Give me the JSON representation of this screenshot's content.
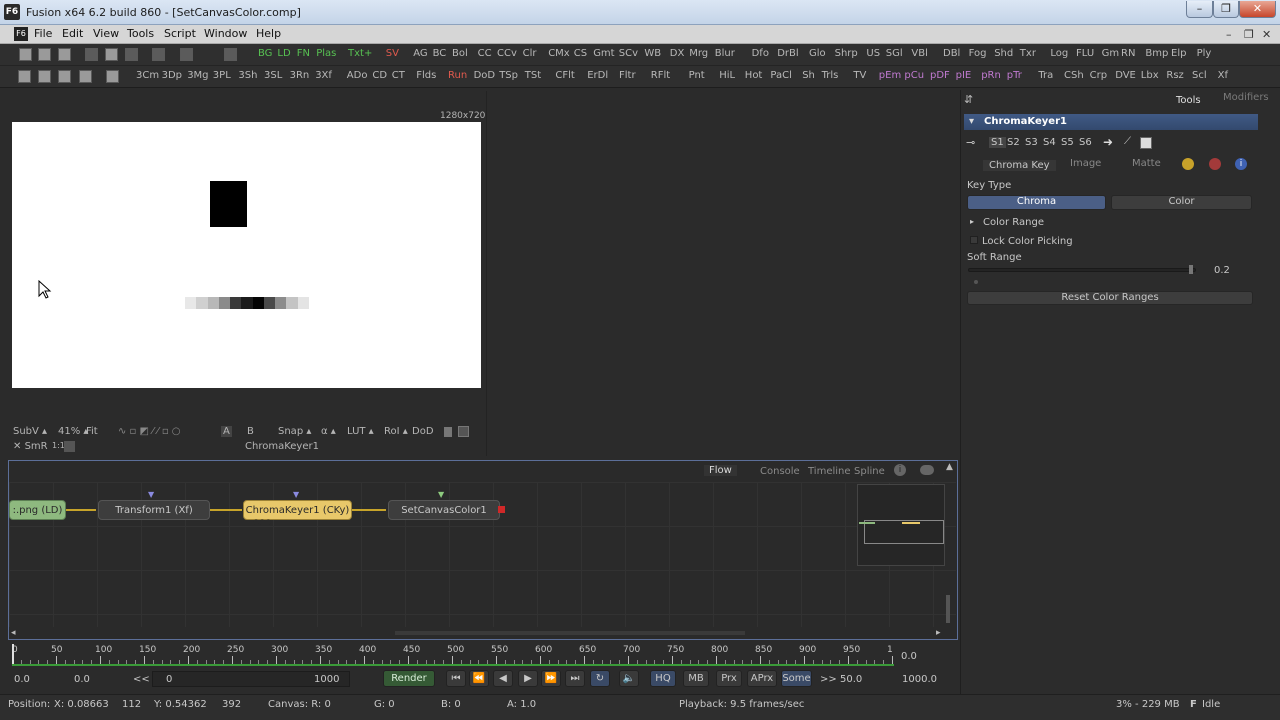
{
  "window": {
    "title": "Fusion x64 6.2 build 860 - [SetCanvasColor.comp]",
    "app_icon": "F6",
    "minimize": "–",
    "restore": "❐",
    "close": "✕"
  },
  "menu": [
    "File",
    "Edit",
    "View",
    "Tools",
    "Script",
    "Window",
    "Help"
  ],
  "toolbar1": {
    "tools": [
      "BG",
      "LD",
      "FN",
      "Plas",
      "Txt+",
      "SV",
      "AG",
      "BC",
      "Bol",
      "CC",
      "CCv",
      "Clr",
      "CMx",
      "CS",
      "Gmt",
      "SCv",
      "WB",
      "DX",
      "Mrg",
      "Blur",
      "Dfo",
      "DrBl",
      "Glo",
      "Shrp",
      "US",
      "SGl",
      "VBl",
      "DBl",
      "Fog",
      "Shd",
      "Txr",
      "Log",
      "FLU",
      "Gm",
      "RN",
      "Bmp",
      "Elp",
      "Ply"
    ]
  },
  "toolbar2": {
    "tools": [
      "3Cm",
      "3Dp",
      "3Mg",
      "3PL",
      "3Sh",
      "3SL",
      "3Rn",
      "3Xf",
      "ADo",
      "CD",
      "CT",
      "Flds",
      "Run",
      "DoD",
      "TSp",
      "TSt",
      "CFlt",
      "ErDl",
      "Fltr",
      "RFlt",
      "Pnt",
      "HiL",
      "Hot",
      "PaCl",
      "Sh",
      "Trls",
      "TV",
      "pEm",
      "pCu",
      "pDF",
      "pIE",
      "pRn",
      "pTr",
      "Tra",
      "CSh",
      "Crp",
      "DVE",
      "Lbx",
      "Rsz",
      "Scl",
      "Xf"
    ]
  },
  "colors": {
    "generator_tool": "#57c152",
    "saver_tool": "#e05a4e",
    "particle_tool": "#c07ad0",
    "run_tool": "#e05a4e",
    "node_selected": "#e8c86a",
    "node_loader": "#8eb97f",
    "accent_blue": "#4b5f86"
  },
  "viewer": {
    "resolution": "1280x720",
    "subv": "SubV ▴",
    "zoom": "41% ▴",
    "fit": "Fit",
    "ab_a": "A",
    "ab_b": "B",
    "snap": "Snap ▴",
    "alpha": "α ▴",
    "lut": "LUT ▴",
    "roi": "RoI ▴",
    "dod": "DoD",
    "smr": "SmR",
    "ratio": "1:1",
    "node_name": "ChromaKeyer1",
    "bar_shades": [
      "#e8e8e8",
      "#d0d0d0",
      "#b8b8b8",
      "#8a8a8a",
      "#3a3a3a",
      "#1c1c1c",
      "#050505",
      "#4a4a4a",
      "#8c8c8c",
      "#c4c4c4",
      "#e4e4e4"
    ]
  },
  "inspector": {
    "tabs": [
      "Tools",
      "Modifiers"
    ],
    "tool_name": "ChromaKeyer1",
    "slots": [
      "S1",
      "S2",
      "S3",
      "S4",
      "S5",
      "S6"
    ],
    "subtabs": [
      "Chroma Key",
      "Image",
      "Matte"
    ],
    "key_type_label": "Key Type",
    "key_type_options": [
      "Chroma",
      "Color"
    ],
    "color_range_label": "Color Range",
    "lock_color_picking_label": "Lock Color Picking",
    "soft_range_label": "Soft Range",
    "soft_range_value": "0.2",
    "soft_range_fraction": 0.98,
    "reset_button": "Reset Color Ranges"
  },
  "flow": {
    "tabs": [
      "Flow",
      "Console",
      "Timeline",
      "Spline"
    ],
    "nodes": [
      {
        "label": ":.png  (LD)",
        "type": "loader"
      },
      {
        "label": "Transform1  (Xf)",
        "type": "normal"
      },
      {
        "label": "ChromaKeyer1  (CKy)",
        "type": "selected"
      },
      {
        "label": "SetCanvasColor1",
        "type": "normal"
      }
    ]
  },
  "timeline": {
    "ticks": [
      "0",
      "50",
      "100",
      "150",
      "200",
      "250",
      "300",
      "350",
      "400",
      "450",
      "500",
      "550",
      "600",
      "650",
      "700",
      "750",
      "800",
      "850",
      "900",
      "950",
      "1"
    ],
    "current_value": "0.0"
  },
  "transport": {
    "global_start": "0.0",
    "render_start": "0.0",
    "rewind_label": "<<",
    "current_frame": "0",
    "render_end": "1000",
    "render_button": "Render",
    "hq": "HQ",
    "mb": "MB",
    "prx": "Prx",
    "aprx": "APrx",
    "some": "Some",
    "ff_label": ">>",
    "step": "50.0",
    "global_end": "1000.0"
  },
  "status": {
    "position_label": "Position:",
    "pos_x": "X: 0.08663",
    "pos_x_px": "112",
    "pos_y": "Y: 0.54362",
    "pos_y_px": "392",
    "canvas_r": "Canvas: R: 0",
    "canvas_g": "G: 0",
    "canvas_b": "B: 0",
    "canvas_a": "A: 1.0",
    "playback": "Playback: 9.5 frames/sec",
    "memory": "3% - 229 MB",
    "state_icon": "F",
    "state": "Idle"
  }
}
